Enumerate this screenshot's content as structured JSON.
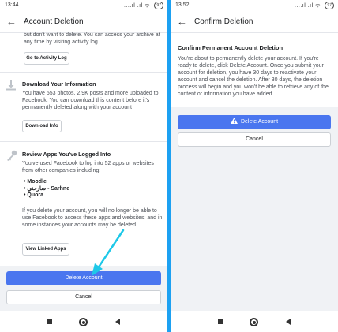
{
  "left": {
    "status": {
      "time": "13:44",
      "signal": "....ıl .ıl ᯤ",
      "battery": "97"
    },
    "header": {
      "title": "Account Deletion"
    },
    "intro_text": "but don't want to delete. You can access your archive at any time by visiting activity log.",
    "activity_log_button": "Go to Activity Log",
    "download": {
      "title": "Download Your Information",
      "text": "You have 553 photos, 2.9K posts and more uploaded to Facebook. You can download this content before it's permanently deleted along with your account",
      "button": "Download Info"
    },
    "apps": {
      "title": "Review Apps You've Logged Into",
      "text": "You've used Facebook to log into 52 apps or websites from other companies including:",
      "items": [
        "Moodle",
        "صارحني - Sarhne",
        "Quora"
      ],
      "warning": "If you delete your account, you will no longer be able to use Facebook to access these apps and websites, and in some instances your accounts may be deleted.",
      "button": "View Linked Apps"
    },
    "delete_button": "Delete Account",
    "cancel_button": "Cancel"
  },
  "right": {
    "status": {
      "time": "13:52",
      "signal": "....ıl .ıl ᯤ",
      "battery": "97"
    },
    "header": {
      "title": "Confirm Deletion"
    },
    "heading": "Confirm Permanent Account Deletion",
    "body": "You're about to permanently delete your account. If you're ready to delete, click Delete Account. Once you submit your account for deletion, you have 30 days to reactivate your account and cancel the deletion. After 30 days, the deletion process will begin and you won't be able to retrieve any of the content or information you have added.",
    "delete_button": "Delete Account",
    "cancel_button": "Cancel"
  },
  "colors": {
    "primary": "#4a76ef",
    "divider": "#1da1f2",
    "arrow": "#1ec8e8",
    "background_gray": "#f0f2f5"
  },
  "icons": [
    "back-arrow-icon",
    "download-icon",
    "key-icon",
    "warning-icon",
    "nav-recents-icon",
    "nav-home-icon",
    "nav-back-icon"
  ]
}
